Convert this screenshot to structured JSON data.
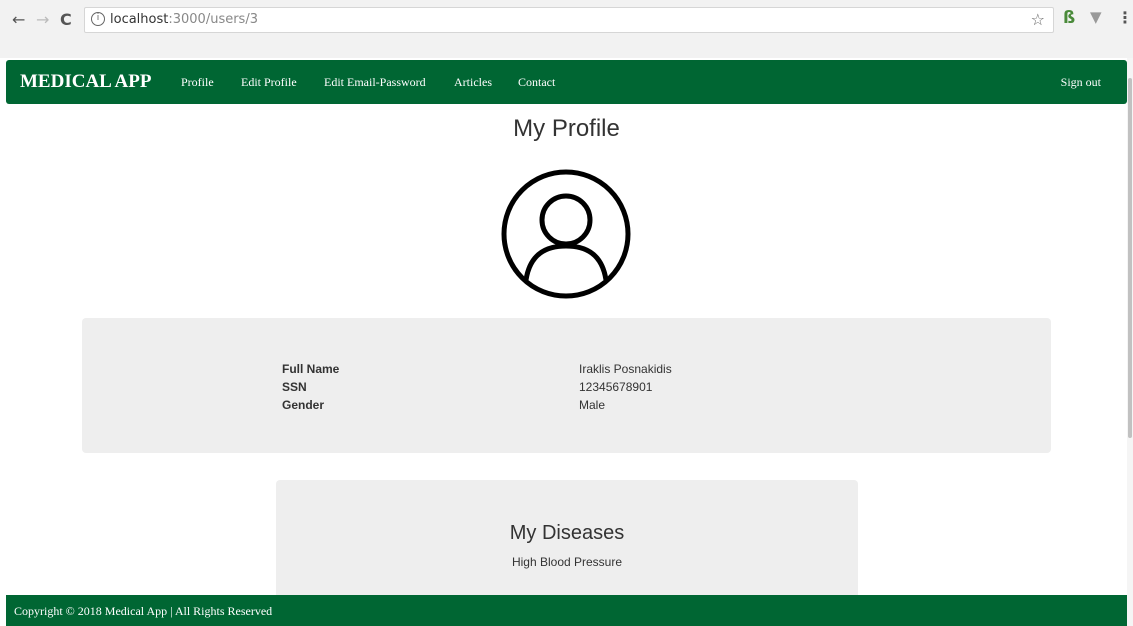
{
  "browser": {
    "url_host": "localhost",
    "url_path": ":3000/users/3",
    "info_glyph": "i"
  },
  "icons": {
    "back": "back-arrow-icon",
    "forward": "forward-arrow-icon",
    "reload": "reload-icon",
    "bookmark": "star-icon",
    "avatar": "user-circle-icon"
  },
  "navbar": {
    "brand": "MEDICAL APP",
    "links": [
      "Profile",
      "Edit Profile",
      "Edit Email-Password",
      "Articles",
      "Contact"
    ],
    "sign_out": "Sign out"
  },
  "main": {
    "title": "My Profile",
    "profile": {
      "labels": [
        "Full Name",
        "SSN",
        "Gender"
      ],
      "values": [
        "Iraklis Posnakidis",
        "12345678901",
        "Male"
      ]
    },
    "diseases": {
      "title": "My Diseases",
      "items": [
        "High Blood Pressure"
      ]
    }
  },
  "footer": {
    "copyright": "Copyright © 2018 Medical App | All Rights Reserved"
  },
  "colors": {
    "brand_green": "#006633",
    "card_gray": "#eeeeee"
  }
}
